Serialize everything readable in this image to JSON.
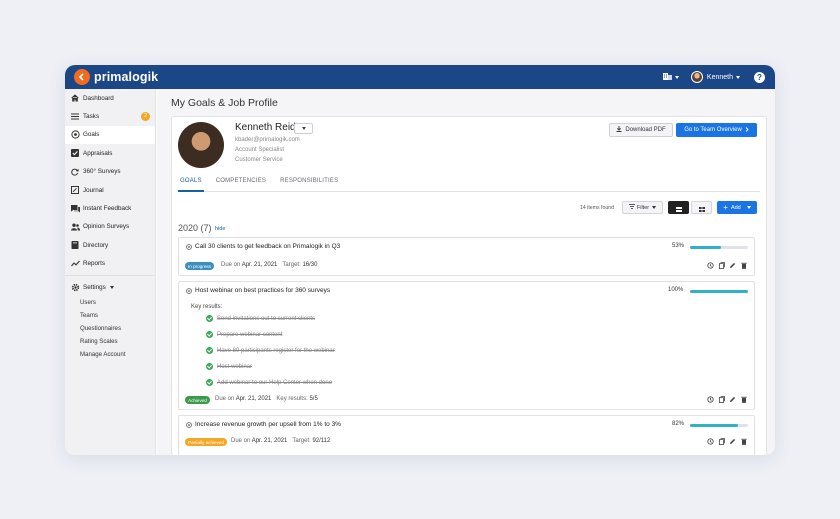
{
  "topbar": {
    "brand": "primalogik",
    "user_name": "Kenneth",
    "help": "?"
  },
  "sidebar": {
    "items": [
      {
        "label": "Dashboard",
        "icon": "home-icon"
      },
      {
        "label": "Tasks",
        "icon": "list-icon",
        "badge": "2"
      },
      {
        "label": "Goals",
        "icon": "target-icon"
      },
      {
        "label": "Appraisals",
        "icon": "check-square-icon"
      },
      {
        "label": "360° Surveys",
        "icon": "cycle-icon"
      },
      {
        "label": "Journal",
        "icon": "journal-icon"
      },
      {
        "label": "Instant Feedback",
        "icon": "chat-icon"
      },
      {
        "label": "Opinion Surveys",
        "icon": "people-icon"
      },
      {
        "label": "Directory",
        "icon": "book-icon"
      },
      {
        "label": "Reports",
        "icon": "trend-icon"
      }
    ],
    "settings_label": "Settings",
    "settings_sub": [
      "Users",
      "Teams",
      "Questionnaires",
      "Rating Scales",
      "Manage Account"
    ]
  },
  "page": {
    "title": "My Goals & Job Profile"
  },
  "profile": {
    "name": "Kenneth Reid",
    "email": "kbader@primalogik.com",
    "title": "Account Specialist",
    "department": "Customer Service",
    "download_pdf": "Download PDF",
    "team_overview": "Go to Team Overview"
  },
  "tabs": [
    "GOALS",
    "COMPETENCIES",
    "RESPONSIBILITIES"
  ],
  "toolbar": {
    "items_found": "14 items found",
    "filter": "Filter",
    "add": "Add"
  },
  "section": {
    "year": "2020 (7)",
    "hide": "hide"
  },
  "colors": {
    "brand_blue": "#1b4787",
    "accent_blue": "#1b74e4",
    "progress": "#2fb1c7",
    "in_progress": "#3b8fbf",
    "achieved": "#3a9a4a",
    "partially_achieved": "#f5a623"
  },
  "goals": [
    {
      "title": "Call 30 clients to get feedback on Primalogik in Q3",
      "percent_label": "53%",
      "progress": 0.53,
      "status": "In progress",
      "due_prefix": "Due on",
      "due_date": "Apr. 21, 2021",
      "target_prefix": "Target:",
      "target_value": "16/30"
    },
    {
      "title": "Host webinar on best practices for 360 surveys",
      "percent_label": "100%",
      "progress": 1.0,
      "key_results_label": "Key results:",
      "key_results": [
        "Send invitations out to current clients",
        "Prepare webinar content",
        "Have 80 participants register for the webinar",
        "Host webinar",
        "Add webinar to our Help Center when done"
      ],
      "status": "Achieved",
      "due_prefix": "Due on",
      "due_date": "Apr. 21, 2021",
      "target_prefix": "Key results:",
      "target_value": "5/5"
    },
    {
      "title": "Increase revenue growth per upsell from 1% to 3%",
      "percent_label": "82%",
      "progress": 0.82,
      "status": "Partially achieved",
      "due_prefix": "Due on",
      "due_date": "Apr. 21, 2021",
      "target_prefix": "Target:",
      "target_value": "92/112"
    }
  ]
}
